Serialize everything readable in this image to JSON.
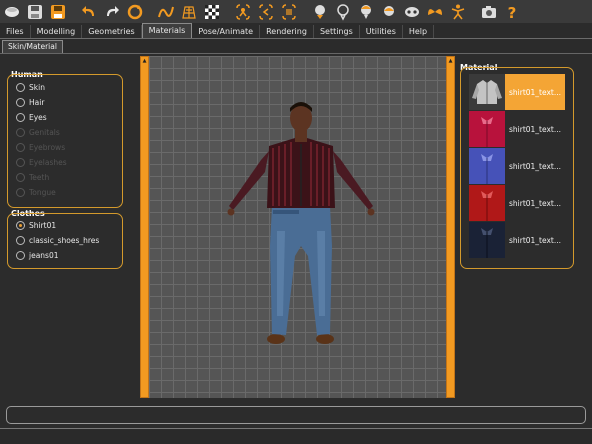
{
  "toolbar": {
    "buttons": [
      "wireframe-toggle-icon",
      "save-icon",
      "export-icon",
      "undo-icon",
      "redo-icon",
      "reset-icon",
      "smooth-icon",
      "subdivide-icon",
      "checker-icon",
      "front-view-icon",
      "back-view-icon",
      "side-view-icon",
      "head-front-icon",
      "head-side-icon",
      "head-back-icon",
      "head-top-icon",
      "mask-icon",
      "wings-icon",
      "pose-icon",
      "camera-icon",
      "help-icon"
    ]
  },
  "menu": {
    "tabs": [
      "Files",
      "Modelling",
      "Geometries",
      "Materials",
      "Pose/Animate",
      "Rendering",
      "Settings",
      "Utilities",
      "Help"
    ],
    "active": "Materials"
  },
  "subtabs": [
    "Skin/Material"
  ],
  "human": {
    "title": "Human",
    "items": [
      {
        "label": "Skin",
        "enabled": true
      },
      {
        "label": "Hair",
        "enabled": true
      },
      {
        "label": "Eyes",
        "enabled": true
      },
      {
        "label": "Genitals",
        "enabled": false
      },
      {
        "label": "Eyebrows",
        "enabled": false
      },
      {
        "label": "Eyelashes",
        "enabled": false
      },
      {
        "label": "Teeth",
        "enabled": false
      },
      {
        "label": "Tongue",
        "enabled": false
      }
    ]
  },
  "clothes": {
    "title": "Clothes",
    "items": [
      {
        "label": "Shirt01",
        "checked": true
      },
      {
        "label": "classic_shoes_hres",
        "checked": false
      },
      {
        "label": "jeans01",
        "checked": false
      }
    ]
  },
  "material": {
    "title": "Material",
    "items": [
      {
        "label": "shirt01_text...",
        "color": "#3a3a3a",
        "accent": "#c3c3c3",
        "selected": true
      },
      {
        "label": "shirt01_text...",
        "color": "#b8123c",
        "accent": "#e86a8a",
        "selected": false
      },
      {
        "label": "shirt01_text...",
        "color": "#4652b8",
        "accent": "#8a94e6",
        "selected": false
      },
      {
        "label": "shirt01_text...",
        "color": "#b01818",
        "accent": "#e25a5a",
        "selected": false
      },
      {
        "label": "shirt01_text...",
        "color": "#1a2236",
        "accent": "#44506e",
        "selected": false
      }
    ]
  },
  "colors": {
    "accent": "#f29a21",
    "viewport_bg": "#555555"
  }
}
